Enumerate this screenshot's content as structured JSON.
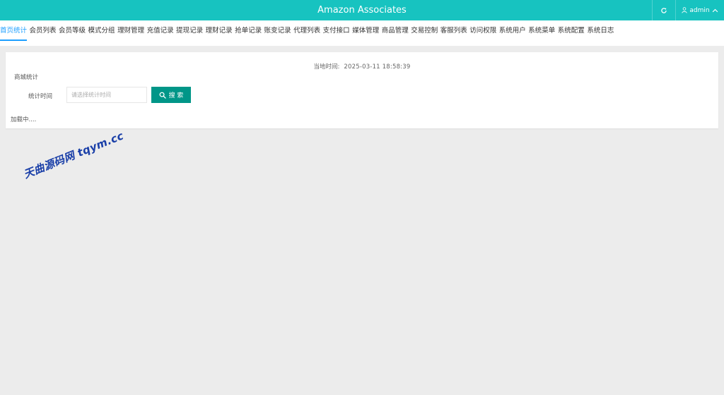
{
  "header": {
    "title": "Amazon Associates",
    "user_label": "admin",
    "accent_color": "#17c3c0",
    "icons": [
      "refresh-icon",
      "user-icon",
      "chevron-up-icon"
    ]
  },
  "nav": {
    "active_color": "#1e9fff",
    "items": [
      {
        "label": "首页统计"
      },
      {
        "label": "会员列表"
      },
      {
        "label": "会员等级"
      },
      {
        "label": "模式分组"
      },
      {
        "label": "理财管理"
      },
      {
        "label": "充值记录"
      },
      {
        "label": "提现记录"
      },
      {
        "label": "理财记录"
      },
      {
        "label": "抢单记录"
      },
      {
        "label": "账变记录"
      },
      {
        "label": "代理列表"
      },
      {
        "label": "支付接口"
      },
      {
        "label": "媒体管理"
      },
      {
        "label": "商品管理"
      },
      {
        "label": "交易控制"
      },
      {
        "label": "客服列表"
      },
      {
        "label": "访问权限"
      },
      {
        "label": "系统用户"
      },
      {
        "label": "系统菜单"
      },
      {
        "label": "系统配置"
      },
      {
        "label": "系统日志"
      }
    ]
  },
  "main": {
    "local_time_label": "当地时间:",
    "local_time_value": "2025-03-11 18:58:39",
    "section_label": "商城统计",
    "filter_label": "统计时间",
    "filter_placeholder": "请选择统计时间",
    "filter_value": "",
    "search_label": "搜 索",
    "search_color": "#009688",
    "loading_text": "加载中...."
  },
  "watermark": {
    "text": "天曲源码网 tqym.cc"
  }
}
